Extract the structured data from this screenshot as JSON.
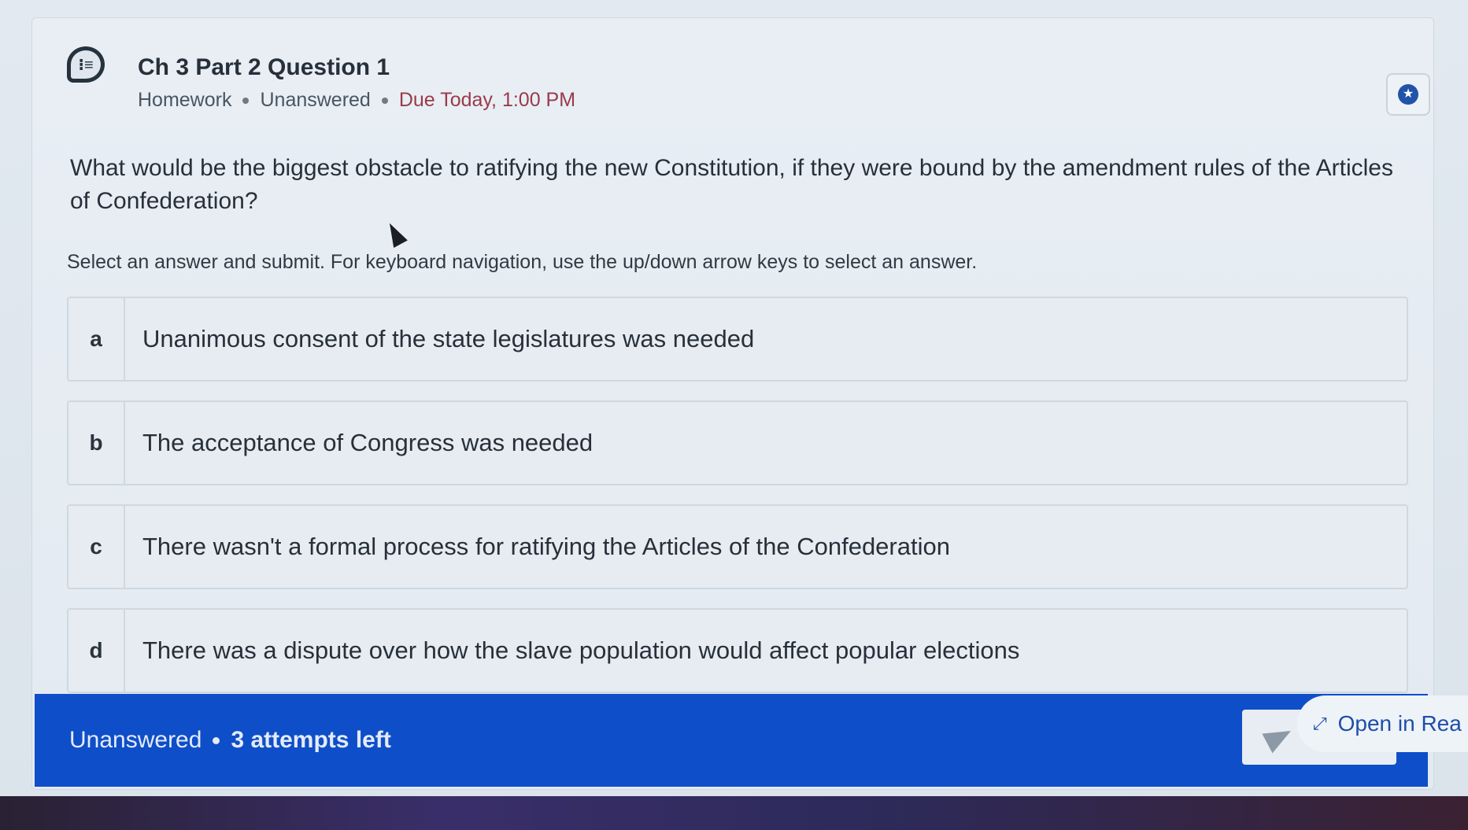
{
  "header": {
    "title": "Ch 3 Part 2 Question 1",
    "type": "Homework",
    "status": "Unanswered",
    "due": "Due Today, 1:00 PM"
  },
  "question": {
    "text": "What would be the biggest obstacle to ratifying the new Constitution, if they were bound by the amendment rules of the Articles of Confederation?",
    "instructions": "Select an answer and submit. For keyboard navigation, use the up/down arrow keys to select an answer."
  },
  "options": [
    {
      "letter": "a",
      "text": "Unanimous consent of the state legislatures was needed"
    },
    {
      "letter": "b",
      "text": "The acceptance of Congress was needed"
    },
    {
      "letter": "c",
      "text": "There wasn't a formal process for ratifying the Articles of the Confederation"
    },
    {
      "letter": "d",
      "text": "There was a dispute over how the slave population would affect popular elections"
    }
  ],
  "footer": {
    "status": "Unanswered",
    "attempts": "3 attempts left",
    "open_reader": "Open in Rea"
  },
  "colors": {
    "accent_blue": "#0e4ec9",
    "due_red": "#9a3a4a"
  },
  "icons": {
    "header": "discussion-list-icon",
    "bookmark": "star-icon",
    "submit": "send-icon",
    "open_reader": "expand-icon"
  }
}
